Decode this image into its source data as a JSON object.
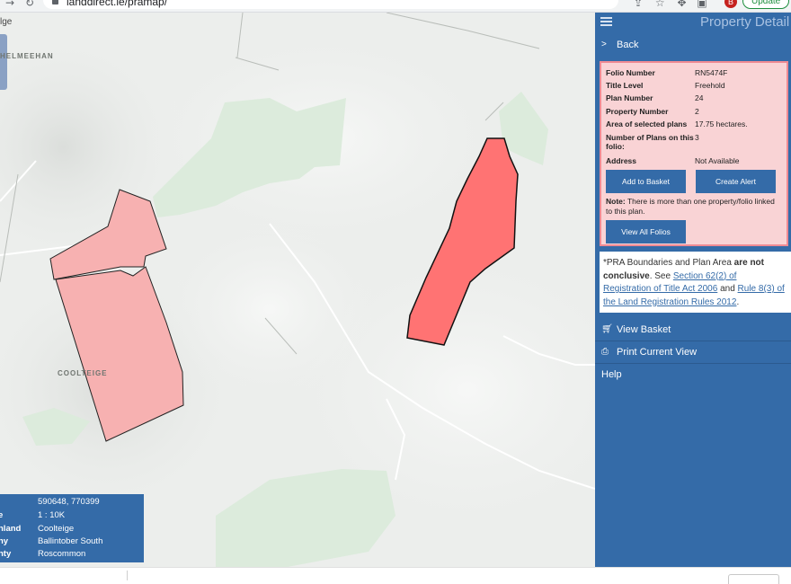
{
  "browser": {
    "url": "landdirect.ie/pramap/",
    "update_label": "Update",
    "avatar_initial": "B"
  },
  "map": {
    "top_link": "lge",
    "townland_label_1": "HELMEEHAN",
    "townland_label_2": "COOLTEIGE",
    "selected_color": "#ff7373",
    "other_color": "#f7b1b1"
  },
  "infobox": {
    "rows": [
      {
        "key": "",
        "value": "590648, 770399"
      },
      {
        "key": "e",
        "value": "1 : 10K"
      },
      {
        "key": "nland",
        "value": "Coolteige"
      },
      {
        "key": "ny",
        "value": "Ballintober South"
      },
      {
        "key": "nty",
        "value": "Roscommon"
      }
    ]
  },
  "panel": {
    "title": "Property Detail",
    "back_label": "Back",
    "details": {
      "rows": [
        {
          "key": "Folio Number",
          "value": "RN5474F"
        },
        {
          "key": "Title Level",
          "value": "Freehold"
        },
        {
          "key": "Plan Number",
          "value": "24"
        },
        {
          "key": "Property Number",
          "value": "2"
        },
        {
          "key": "Area of selected plans",
          "value": "17.75 hectares."
        },
        {
          "key": "Number of Plans on this folio:",
          "value": "3"
        },
        {
          "key": "Address",
          "value": "Not Available"
        }
      ],
      "add_to_basket": "Add to Basket",
      "create_alert": "Create Alert",
      "note_label": "Note:",
      "note_text": " There is more than one property/folio linked to this plan.",
      "view_all_folios": "View All Folios"
    },
    "disclaimer": {
      "part1": "*PRA Boundaries and Plan Area ",
      "bold": "are not conclusive",
      "part2": ". See ",
      "link1": "Section 62(2) of Registration of Title Act 2006",
      "part3": " and ",
      "link2": "Rule 8(3) of the Land Registration Rules 2012",
      "part4": "."
    },
    "view_basket": "View Basket",
    "print_view": "Print Current View",
    "help": "Help"
  }
}
